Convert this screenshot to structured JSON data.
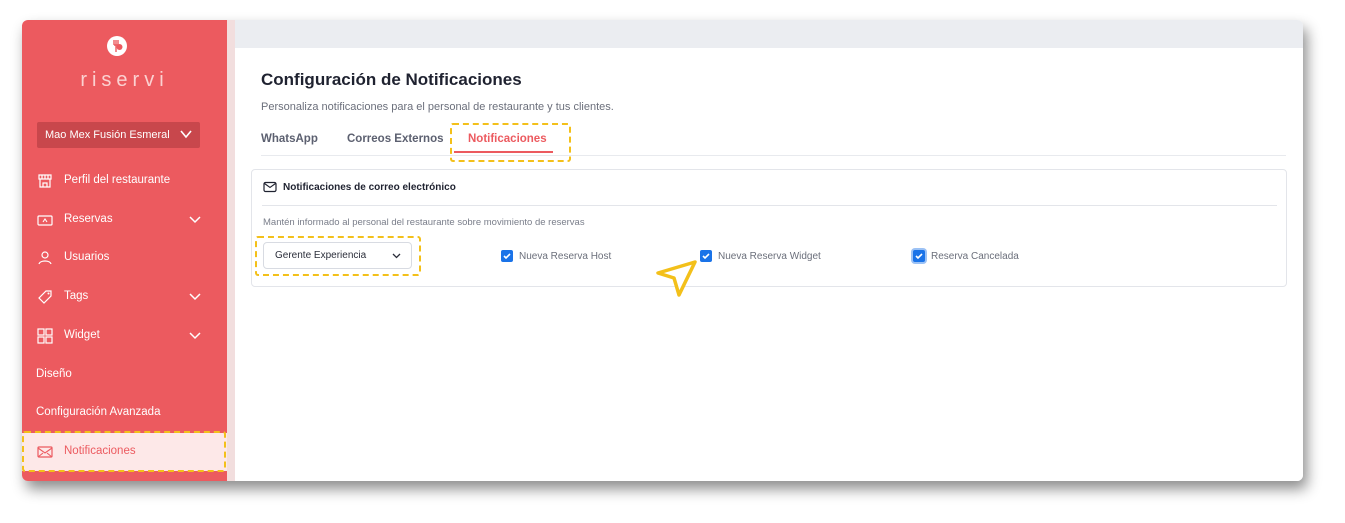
{
  "brand": {
    "name": "riservi"
  },
  "restaurant": {
    "selected": "Mao Mex Fusión Esmeral"
  },
  "sidebar": {
    "items": [
      {
        "label": "Perfil del restaurante",
        "icon": "store-icon"
      },
      {
        "label": "Reservas",
        "icon": "ticket-icon",
        "expandable": true
      },
      {
        "label": "Usuarios",
        "icon": "user-icon"
      },
      {
        "label": "Tags",
        "icon": "tag-icon",
        "expandable": true
      },
      {
        "label": "Widget",
        "icon": "grid-icon",
        "expandable": true
      },
      {
        "label": "Diseño"
      },
      {
        "label": "Configuración Avanzada"
      },
      {
        "label": "Notificaciones",
        "icon": "mail-icon",
        "active": true
      }
    ]
  },
  "page": {
    "title": "Configuración de Notificaciones",
    "subtitle": "Personaliza notificaciones para el personal de restaurante y tus clientes."
  },
  "tabs": [
    {
      "label": "WhatsApp"
    },
    {
      "label": "Correos Externos"
    },
    {
      "label": "Notificaciones",
      "active": true
    }
  ],
  "card": {
    "title": "Notificaciones de correo electrónico",
    "description": "Mantén informado al personal del restaurante sobre movimiento de reservas",
    "role_select": {
      "value": "Gerente Experiencia"
    },
    "checkboxes": [
      {
        "label": "Nueva Reserva Host",
        "checked": true
      },
      {
        "label": "Nueva Reserva Widget",
        "checked": true
      },
      {
        "label": "Reserva Cancelada",
        "checked": true
      }
    ]
  },
  "colors": {
    "brand": "#ec5a5f",
    "highlight": "#f3c01a",
    "checkbox": "#1a73e8"
  }
}
